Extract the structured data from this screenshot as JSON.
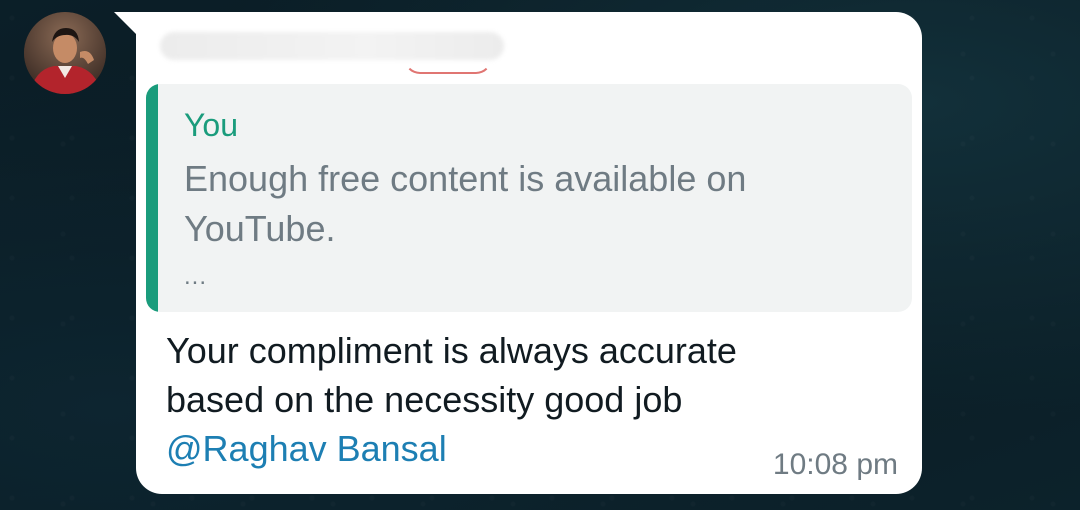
{
  "message": {
    "sender": {
      "name": "",
      "avatar": "profile-photo"
    },
    "quoted": {
      "author": "You",
      "text": "Enough free content is available on YouTube.",
      "ellipsis": "..."
    },
    "body": {
      "line1": "Your compliment is always accurate",
      "line2": "based on the necessity good job",
      "mention": "@Raghav Bansal"
    },
    "time": "10:08 pm"
  },
  "colors": {
    "quote_accent": "#1a9c7c",
    "mention": "#1d7fb3",
    "bubble": "#ffffff",
    "background": "#0b1f28"
  }
}
